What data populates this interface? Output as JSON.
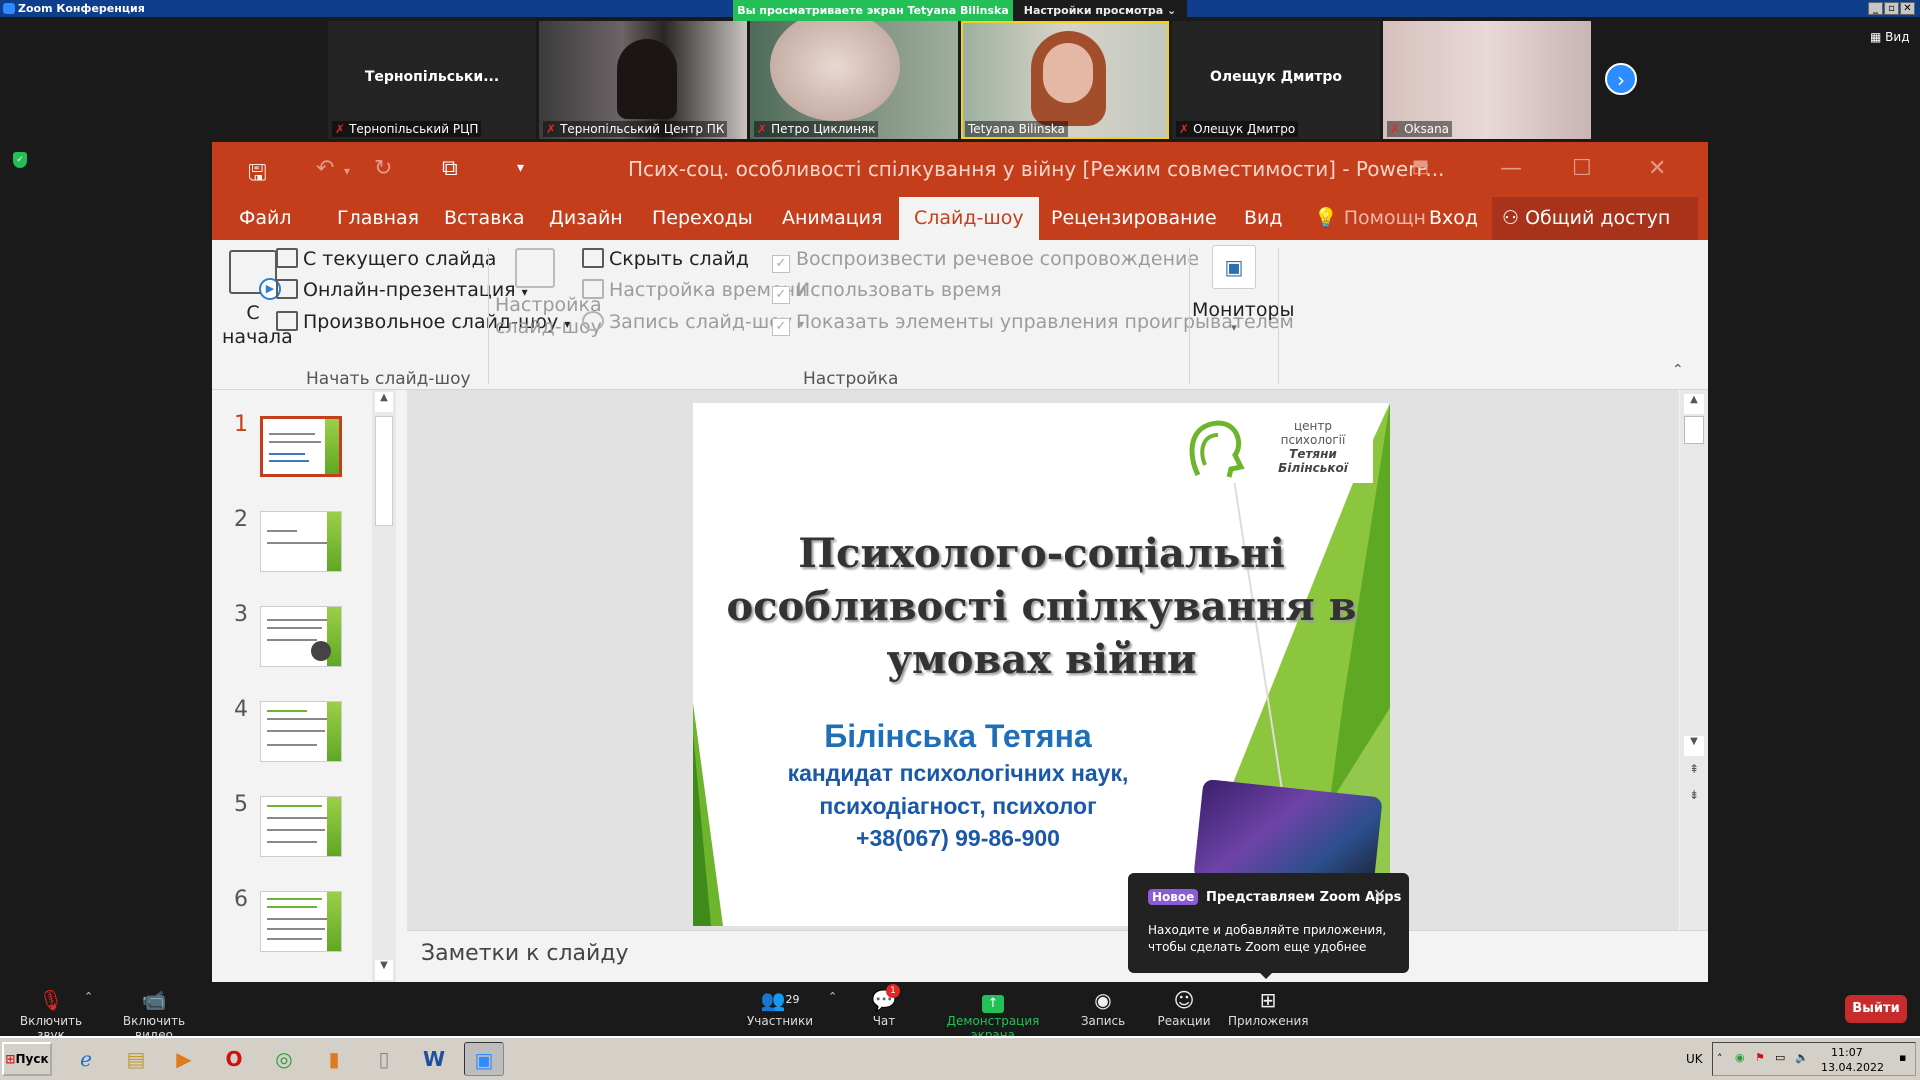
{
  "zoom": {
    "window_title": "Zoom Конференция",
    "viewing_banner": "Вы просматриваете экран Tetyana Bilinska",
    "view_settings": "Настройки просмотра",
    "view_btn": "Вид",
    "participants": [
      {
        "display": "Тернопільськи...",
        "label": "Тернопільський РЦП"
      },
      {
        "display": "",
        "label": "Тернопільський Центр ПК"
      },
      {
        "display": "",
        "label": "Петро Циклиняк"
      },
      {
        "display": "",
        "label": "Tetyana Bilinska"
      },
      {
        "display": "Олещук Дмитро",
        "label": "Олещук Дмитро"
      },
      {
        "display": "",
        "label": "Oksana"
      }
    ],
    "toolbar": {
      "audio": "Включить звук",
      "video": "Включить видео",
      "participants": "Участники",
      "participants_count": "29",
      "chat": "Чат",
      "chat_badge": "1",
      "share": "Демонстрация экрана",
      "record": "Запись",
      "reactions": "Реакции",
      "apps": "Приложения",
      "leave": "Выйти"
    },
    "popup": {
      "badge": "Новое",
      "title": "Представляем Zoom Apps",
      "body": "Находите и добавляйте приложения, чтобы сделать Zoom еще удобнее"
    }
  },
  "ppt": {
    "title": "Псих-соц. особливості спілкування у війну [Режим совместимости] - PowerP...",
    "tabs": [
      "Файл",
      "Главная",
      "Вставка",
      "Дизайн",
      "Переходы",
      "Анимация",
      "Слайд-шоу",
      "Рецензирование",
      "Вид",
      "Помощн",
      "Вход",
      "Общий доступ"
    ],
    "ribbon": {
      "from_start_1": "С",
      "from_start_2": "начала",
      "from_current": "С текущего слайда",
      "online": "Онлайн-презентация",
      "custom": "Произвольное слайд-шоу",
      "group_start": "Начать слайд-шоу",
      "setup_1": "Настройка",
      "setup_2": "слайд-шоу",
      "hide": "Скрыть слайд",
      "timing": "Настройка времени",
      "record": "Запись слайд-шоу",
      "narration": "Воспроизвести речевое сопровождение",
      "use_timing": "Использовать время",
      "controls": "Показать элементы управления проигрывателем",
      "group_setup": "Настройка",
      "monitors": "Мониторы"
    },
    "slide_numbers": [
      "1",
      "2",
      "3",
      "4",
      "5",
      "6"
    ],
    "notes": "Заметки к слайду",
    "slide": {
      "logo_1": "центр",
      "logo_2": "психології",
      "logo_3": "Тетяни Білінської",
      "title_1": "Психолого-соціальні",
      "title_2": "особливості спілкування в",
      "title_3": "умовах війни",
      "author": "Білінська Тетяна",
      "line_1": "кандидат психологічних наук,",
      "line_2": "психодіагност, психолог",
      "phone": "+38(067) 99-86-900"
    }
  },
  "taskbar": {
    "start": "Пуск",
    "lang": "UK",
    "time": "11:07",
    "date": "13.04.2022"
  },
  "colors": {
    "ppt_accent": "#c43e1c",
    "zoom_blue": "#2d8cff",
    "zoom_green": "#23c058",
    "slide_green": "#6cb52d",
    "slide_blue": "#1f6fb8"
  }
}
